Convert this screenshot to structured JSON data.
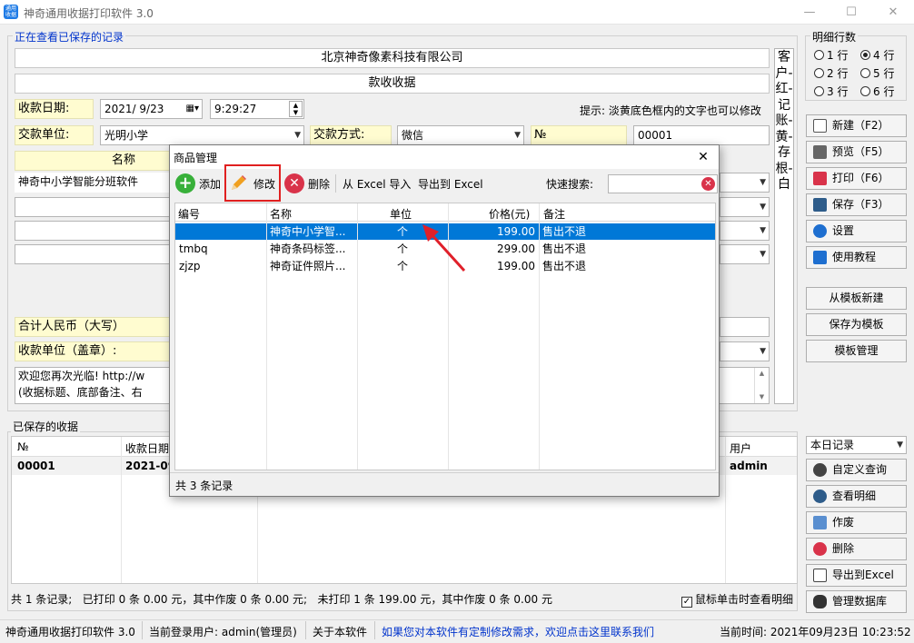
{
  "window": {
    "title": "神奇通用收据打印软件 3.0",
    "icon_text": "通用\n收据",
    "minimize": "—",
    "maximize": "☐",
    "close": "✕"
  },
  "form": {
    "viewing_label": "正在查看已保存的记录",
    "company": "北京神奇像素科技有限公司",
    "doc_title": "款收收据",
    "date_label": "收款日期:",
    "date_value": "2021/ 9/23",
    "time_value": "9:29:27",
    "hint": "提示: 淡黄底色框内的文字也可以修改",
    "payer_label": "交款单位:",
    "payer_value": "光明小学",
    "method_label": "交款方式:",
    "method_value": "微信",
    "no_label": "№",
    "no_value": "00001",
    "col_name": "名称",
    "item1": "神奇中小学智能分班软件",
    "total_label": "合计人民币（大写）",
    "receiver_label": "收款单位（盖章）:",
    "remark_line1": "欢迎您再次光临! http://w",
    "remark_line2": "(收据标题、底部备注、右",
    "side_text": "客户-红-记账-黄-存根-白"
  },
  "detail_rows": {
    "label": "明细行数",
    "options": [
      "1 行",
      "4 行",
      "2 行",
      "5 行",
      "3 行",
      "6 行"
    ],
    "selected": "4 行"
  },
  "right_buttons": {
    "new": "新建（F2）",
    "preview": "预览（F5）",
    "print": "打印（F6）",
    "save": "保存（F3）",
    "settings": "设置",
    "tutorial": "使用教程",
    "from_template": "从模板新建",
    "save_template": "保存为模板",
    "template_mgmt": "模板管理",
    "range": "本日记录",
    "custom_query": "自定义查询",
    "view_detail": "查看明细",
    "void": "作废",
    "delete": "删除",
    "export_excel": "导出到Excel",
    "manage_db": "管理数据库"
  },
  "saved": {
    "label": "已保存的收据",
    "headers": [
      "№",
      "收款日期",
      "用户"
    ],
    "rows": [
      {
        "no": "00001",
        "date": "2021-09",
        "user": "admin"
      }
    ],
    "summary": "共 1 条记录;   已打印 0 条 0.00 元，其中作废 0 条 0.00 元;   未打印 1 条 199.00 元，其中作废 0 条 0.00 元",
    "click_detail": "鼠标单击时查看明细"
  },
  "dialog": {
    "title": "商品管理",
    "close": "✕",
    "toolbar": {
      "add": "添加",
      "edit": "修改",
      "delete": "删除",
      "import": "从 Excel 导入",
      "export": "导出到 Excel",
      "search_label": "快速搜索:",
      "search_value": ""
    },
    "headers": [
      "编号",
      "名称",
      "单位",
      "价格(元)",
      "备注"
    ],
    "rows": [
      {
        "code": "",
        "name": "神奇中小学智...",
        "unit": "个",
        "price": "199.00",
        "note": "售出不退"
      },
      {
        "code": "tmbq",
        "name": "神奇条码标签...",
        "unit": "个",
        "price": "299.00",
        "note": "售出不退"
      },
      {
        "code": "zjzp",
        "name": "神奇证件照片...",
        "unit": "个",
        "price": "199.00",
        "note": "售出不退"
      }
    ],
    "footer": "共 3 条记录"
  },
  "statusbar": {
    "app": "神奇通用收据打印软件 3.0",
    "user": "当前登录用户: admin(管理员)",
    "about": "关于本软件",
    "link": "如果您对本软件有定制修改需求，欢迎点击这里联系我们",
    "time": "当前时间: 2021年09月23日  10:23:52"
  },
  "colors": {
    "accent": "#0078d7",
    "link": "#0033cc",
    "highlight_box": "#e02020",
    "arrow": "#e0202a",
    "yellow_field": "#fffcd0"
  }
}
